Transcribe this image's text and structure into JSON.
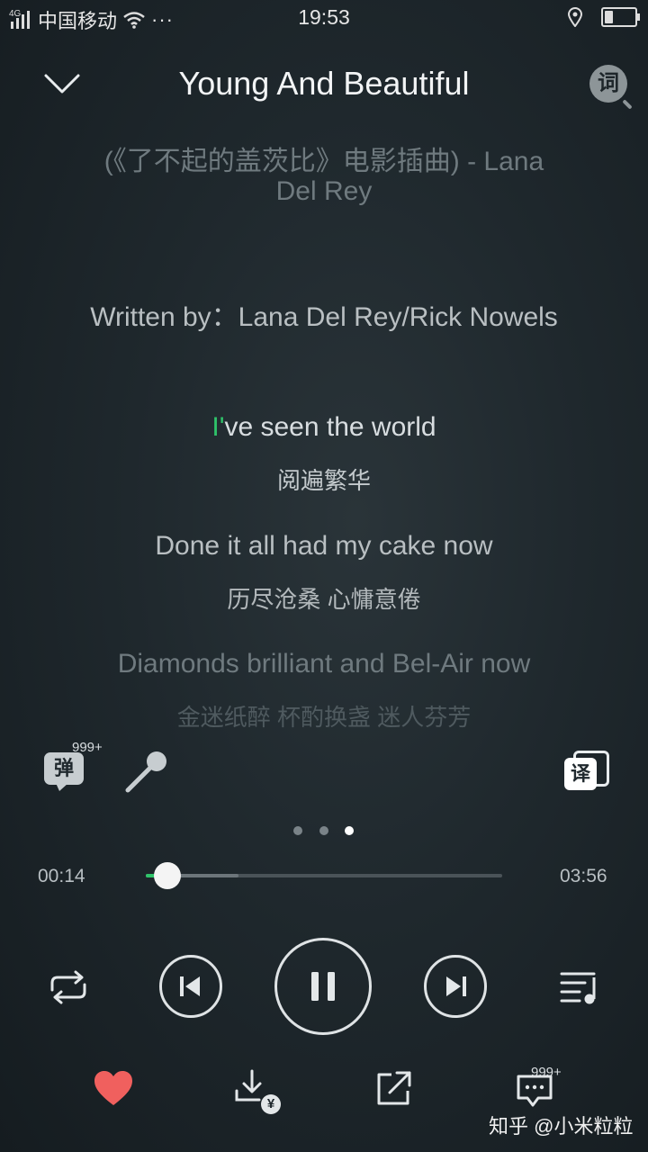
{
  "status_bar": {
    "network": "4G",
    "carrier": "中国移动",
    "more": "···",
    "time": "19:53",
    "battery_level": 0.3
  },
  "header": {
    "title": "Young And Beautiful",
    "lyrics_button_label": "词"
  },
  "lyrics": {
    "subtitle_line1": "(《了不起的盖茨比》电影插曲) - Lana",
    "subtitle_line2": "Del Rey",
    "written_by": "Written by：Lana Del Rey/Rick Nowels",
    "current_sung": "I'",
    "current_rest": "ve seen the world",
    "current_translation": "阅遍繁华",
    "next_line": "Done it all had my cake now",
    "next_translation": "历尽沧桑 心慵意倦",
    "later_line": "Diamonds brilliant and Bel-Air now",
    "later_translation": "金迷纸醉 杯酌换盏 迷人芬芳"
  },
  "tools": {
    "danmu_label": "弹",
    "danmu_count": "999+",
    "translate_label": "译"
  },
  "pager": {
    "pages": 3,
    "active": 3
  },
  "progress": {
    "elapsed": "00:14",
    "duration": "03:56",
    "played_fraction": 0.06,
    "buffered_fraction": 0.26
  },
  "bottom": {
    "comment_count": "999+",
    "download_badge": "¥"
  },
  "watermark": "知乎 @小米粒粒",
  "colors": {
    "accent": "#2fc46a",
    "heart": "#f0605e"
  }
}
